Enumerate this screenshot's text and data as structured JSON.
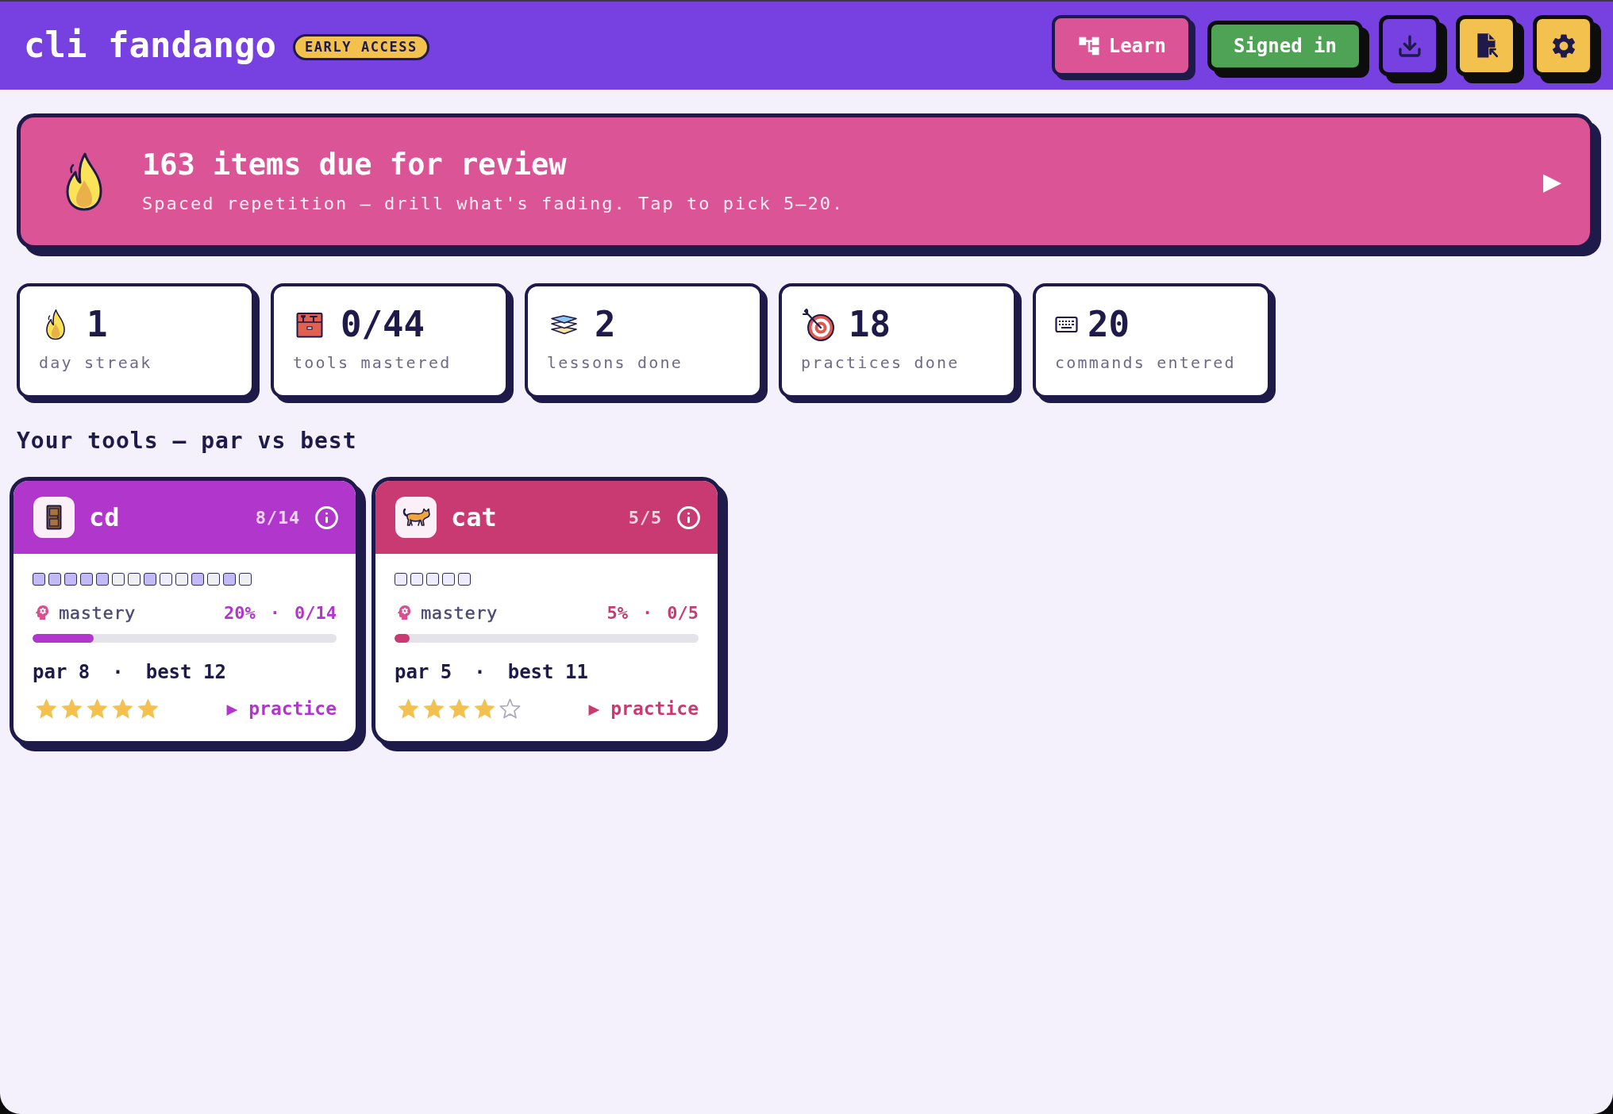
{
  "header": {
    "title": "cli fandango",
    "badge": "EARLY ACCESS",
    "buttons": [
      {
        "label": "Learn"
      },
      {
        "label": "Signed in"
      }
    ]
  },
  "review_banner": {
    "title": "163 items due for review",
    "subtitle": "Spaced repetition — drill what's fading. Tap to pick 5–20.",
    "arrow": "▶"
  },
  "stats": [
    {
      "value": "1",
      "label": "day streak"
    },
    {
      "value": "0/44",
      "label": "tools mastered"
    },
    {
      "value": "2",
      "label": "lessons done"
    },
    {
      "value": "18",
      "label": "practices done"
    },
    {
      "value": "20",
      "label": "commands entered"
    }
  ],
  "tools_section": {
    "heading": "Your tools — par vs best",
    "tools": [
      {
        "name": "cd",
        "count": "8/14",
        "color": "#b036cc",
        "squares": [
          {
            "kind": "filled"
          },
          {
            "kind": "filled"
          },
          {
            "kind": "filled"
          },
          {
            "kind": "filled"
          },
          {
            "kind": "filled"
          },
          {
            "kind": "empty"
          },
          {
            "kind": "empty"
          },
          {
            "kind": "filled"
          },
          {
            "kind": "pale"
          },
          {
            "kind": "empty"
          },
          {
            "kind": "filled"
          },
          {
            "kind": "empty"
          },
          {
            "kind": "filled"
          },
          {
            "kind": "empty"
          }
        ],
        "mastery_label": "mastery",
        "percent": "20%",
        "separator": "·",
        "ratio": "0/14",
        "level": 0.2,
        "par": "par 8",
        "par_separator": "·",
        "best": "best 12",
        "stars": 5,
        "action": "▶ practice"
      },
      {
        "name": "cat",
        "count": "5/5",
        "color": "#c93a73",
        "squares": [
          {
            "kind": "pale"
          },
          {
            "kind": "pale"
          },
          {
            "kind": "pale"
          },
          {
            "kind": "pale"
          },
          {
            "kind": "pale"
          }
        ],
        "mastery_label": "mastery",
        "percent": "5%",
        "separator": "·",
        "ratio": "0/5",
        "level": 0.05,
        "par": "par 5",
        "par_separator": "·",
        "best": "best 11",
        "stars": 4,
        "action": "▶ practice"
      }
    ]
  }
}
